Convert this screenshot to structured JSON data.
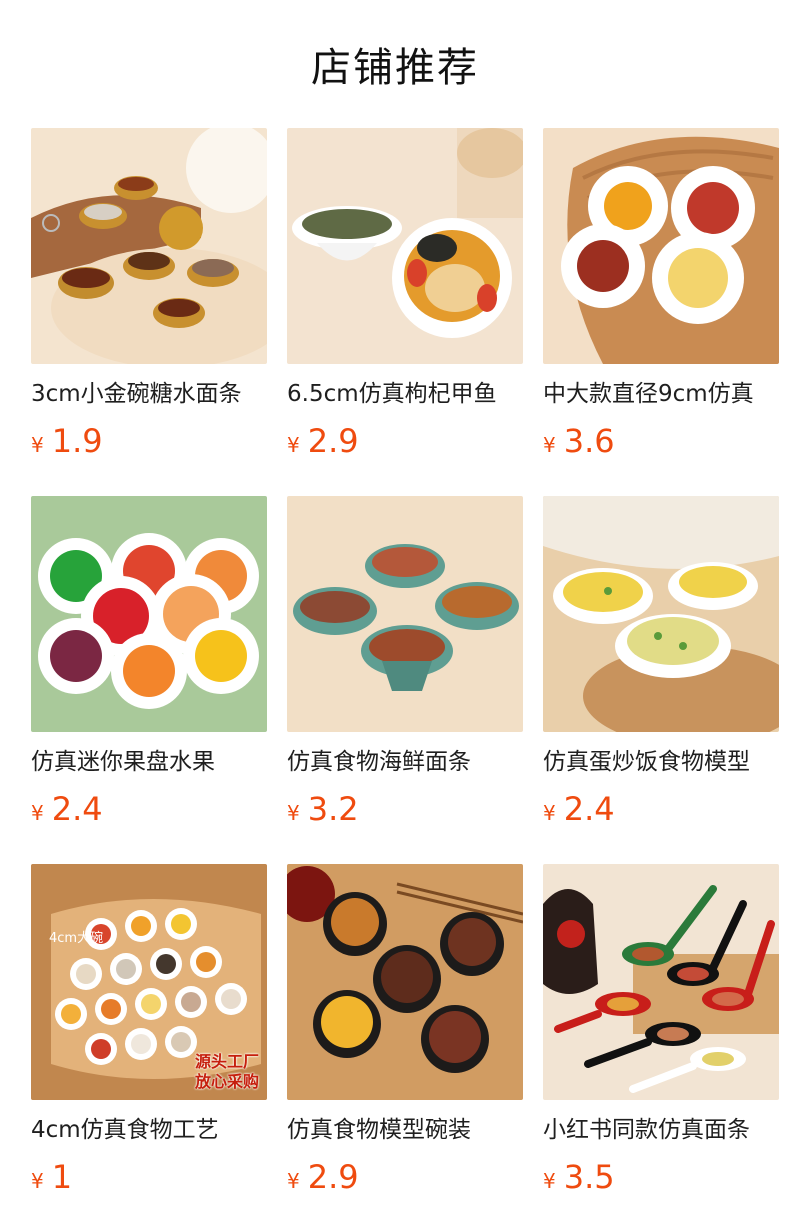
{
  "header": {
    "title": "店铺推荐"
  },
  "products": [
    {
      "title": "3cm小金碗糖水面条",
      "currency": "¥",
      "price": "1.9",
      "image_icon": "gold-bowl-keychain-image"
    },
    {
      "title": "6.5cm仿真枸杞甲鱼",
      "currency": "¥",
      "price": "2.9",
      "image_icon": "turtle-soup-bowl-image"
    },
    {
      "title": "中大款直径9cm仿真",
      "currency": "¥",
      "price": "3.6",
      "image_icon": "plates-on-board-image"
    },
    {
      "title": "仿真迷你果盘水果",
      "currency": "¥",
      "price": "2.4",
      "image_icon": "fruit-plates-image"
    },
    {
      "title": "仿真食物海鲜面条",
      "currency": "¥",
      "price": "3.2",
      "image_icon": "noodle-bowls-image"
    },
    {
      "title": "仿真蛋炒饭食物模型",
      "currency": "¥",
      "price": "2.4",
      "image_icon": "fried-rice-plates-image"
    },
    {
      "title": "4cm仿真食物工艺",
      "currency": "¥",
      "price": "1",
      "image_icon": "cutting-board-bowls-image",
      "overlay_text": [
        "源头工厂",
        "放心采购"
      ],
      "handwritten_text": "4cm大碗"
    },
    {
      "title": "仿真食物模型碗装",
      "currency": "¥",
      "price": "2.9",
      "image_icon": "black-bowls-tray-image"
    },
    {
      "title": "小红书同款仿真面条",
      "currency": "¥",
      "price": "3.5",
      "image_icon": "spoons-image"
    }
  ]
}
